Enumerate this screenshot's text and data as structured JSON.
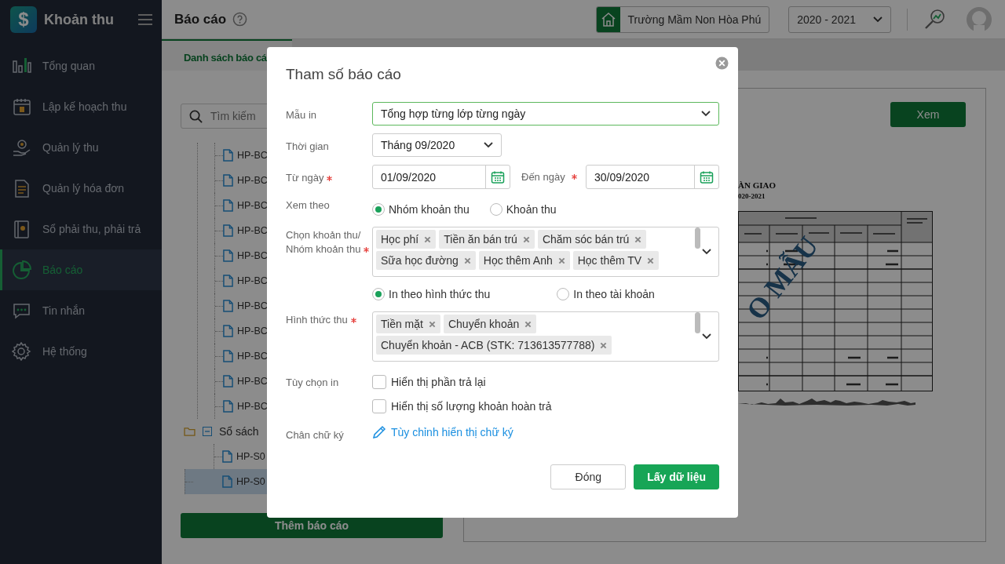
{
  "sidebar": {
    "logo_mark": "$",
    "app_title": "Khoản thu",
    "items": [
      {
        "label": "Tổng quan",
        "selected": false
      },
      {
        "label": "Lập kế hoạch thu",
        "selected": false
      },
      {
        "label": "Quản lý thu",
        "selected": false
      },
      {
        "label": "Quản lý hóa đơn",
        "selected": false
      },
      {
        "label": "Sổ phải thu, phải trả",
        "selected": false
      },
      {
        "label": "Báo cáo",
        "selected": true
      },
      {
        "label": "Tin nhắn",
        "selected": false
      },
      {
        "label": "Hệ thống",
        "selected": false
      }
    ]
  },
  "header": {
    "title": "Báo cáo",
    "school": "Trường Mầm Non Hòa Phú",
    "year": "2020 - 2021"
  },
  "tabs": [
    {
      "label": "Danh sách báo cá",
      "selected": true
    }
  ],
  "report_list": {
    "search_placeholder": "Tìm kiếm",
    "tree": [
      {
        "kind": "file",
        "label": "HP-BC",
        "selected": false
      },
      {
        "kind": "file",
        "label": "HP-BC",
        "selected": false
      },
      {
        "kind": "file",
        "label": "HP-BC",
        "selected": false
      },
      {
        "kind": "file",
        "label": "HP-BC",
        "selected": false
      },
      {
        "kind": "file",
        "label": "HP-BC",
        "selected": false
      },
      {
        "kind": "file",
        "label": "HP-BC",
        "selected": false
      },
      {
        "kind": "file",
        "label": "HP-BC",
        "selected": false
      },
      {
        "kind": "file",
        "label": "HP-BC",
        "selected": false
      },
      {
        "kind": "file",
        "label": "HP-BC",
        "selected": false
      },
      {
        "kind": "file",
        "label": "HP-BC",
        "selected": false
      },
      {
        "kind": "file",
        "label": "HP-BC",
        "selected": false
      },
      {
        "kind": "folder",
        "label": "Sổ sách",
        "expanded": true,
        "children": [
          {
            "kind": "file",
            "label": "HP-S0",
            "selected": false
          },
          {
            "kind": "file",
            "label": "HP-S0",
            "selected": true
          }
        ]
      }
    ],
    "add_button": "Thêm báo cáo"
  },
  "preview": {
    "button": "Xem",
    "document": {
      "title": "ÀN GIAO",
      "subtitle": "020-2021",
      "stamp": "O MẪU"
    }
  },
  "dialog": {
    "title": "Tham số báo cáo",
    "template": {
      "label": "Mẫu in",
      "value": "Tổng hợp từng lớp từng ngày"
    },
    "period": {
      "label": "Thời gian",
      "value": "Tháng 09/2020"
    },
    "from": {
      "label": "Từ ngày",
      "required": true,
      "value": "01/09/2020"
    },
    "to": {
      "label": "Đến ngày",
      "required": true,
      "value": "30/09/2020"
    },
    "view_by": {
      "label": "Xem theo",
      "options": [
        {
          "label": "Nhóm khoản thu",
          "selected": true
        },
        {
          "label": "Khoản thu",
          "selected": false
        }
      ]
    },
    "fees": {
      "label": "Chọn khoản thu/ Nhóm khoản thu",
      "required": true,
      "tags": [
        "Học phí",
        "Tiền ăn bán trú",
        "Chăm sóc bán trú",
        "Sữa học đường",
        "Học thêm Anh",
        "Học thêm TV"
      ]
    },
    "print_by": {
      "options": [
        {
          "label": "In theo hình thức thu",
          "selected": true
        },
        {
          "label": "In theo tài khoản",
          "selected": false
        }
      ]
    },
    "methods": {
      "label": "Hình thức thu",
      "required": true,
      "tags": [
        "Tiền mặt",
        "Chuyển khoản",
        "Chuyển khoản - ACB (STK: 713613577788)"
      ]
    },
    "print_options": {
      "label": "Tùy chọn in",
      "items": [
        {
          "label": "Hiển thị phần trả lại",
          "checked": false
        },
        {
          "label": "Hiển thị số lượng khoản hoàn trả",
          "checked": false
        }
      ]
    },
    "signature": {
      "label": "Chân chữ ký",
      "link": "Tùy chỉnh hiển thị chữ ký"
    },
    "buttons": [
      {
        "label": "Đóng",
        "kind": "secondary"
      },
      {
        "label": "Lấy dữ liệu",
        "kind": "primary"
      }
    ]
  }
}
